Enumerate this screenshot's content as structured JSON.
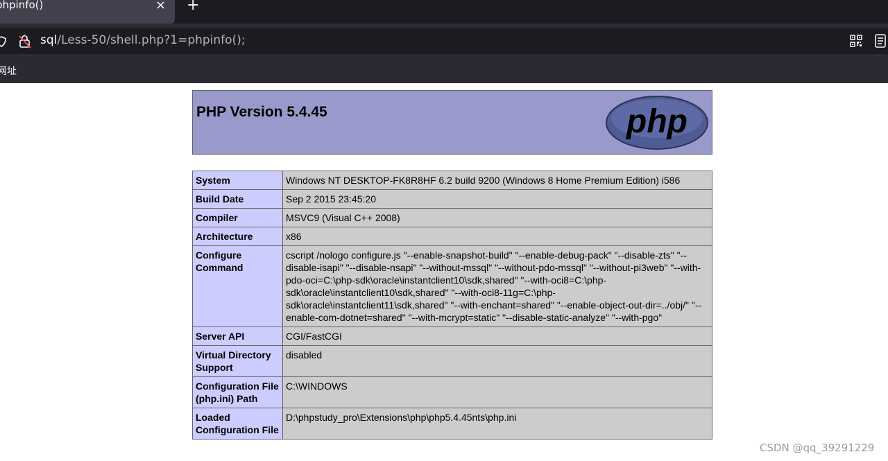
{
  "browser": {
    "tab_title": "phpinfo()",
    "tab_close": "×",
    "new_tab": "+",
    "url_host": "sql",
    "url_path": "/Less-50/shell.php?1=phpinfo();",
    "bookmark_label": "网址",
    "icons": [
      "shield-icon",
      "lock-icon",
      "qr-code-icon",
      "reader-view-icon",
      "close-icon",
      "plus-icon"
    ]
  },
  "page": {
    "heading": "PHP Version 5.4.45",
    "logo_text": "php",
    "rows": [
      {
        "key": "System",
        "value": "Windows NT DESKTOP-FK8R8HF 6.2 build 9200 (Windows 8 Home Premium Edition) i586"
      },
      {
        "key": "Build Date",
        "value": "Sep 2 2015 23:45:20"
      },
      {
        "key": "Compiler",
        "value": "MSVC9 (Visual C++ 2008)"
      },
      {
        "key": "Architecture",
        "value": "x86"
      },
      {
        "key": "Configure Command",
        "value": "cscript /nologo configure.js \"--enable-snapshot-build\" \"--enable-debug-pack\" \"--disable-zts\" \"--disable-isapi\" \"--disable-nsapi\" \"--without-mssql\" \"--without-pdo-mssql\" \"--without-pi3web\" \"--with-pdo-oci=C:\\php-sdk\\oracle\\instantclient10\\sdk,shared\" \"--with-oci8=C:\\php-sdk\\oracle\\instantclient10\\sdk,shared\" \"--with-oci8-11g=C:\\php-sdk\\oracle\\instantclient11\\sdk,shared\" \"--with-enchant=shared\" \"--enable-object-out-dir=../obj/\" \"--enable-com-dotnet=shared\" \"--with-mcrypt=static\" \"--disable-static-analyze\" \"--with-pgo\""
      },
      {
        "key": "Server API",
        "value": "CGI/FastCGI"
      },
      {
        "key": "Virtual Directory Support",
        "value": "disabled"
      },
      {
        "key": "Configuration File (php.ini) Path",
        "value": "C:\\WINDOWS"
      },
      {
        "key": "Loaded Configuration File",
        "value": "D:\\phpstudy_pro\\Extensions\\php\\php5.4.45nts\\php.ini"
      }
    ]
  },
  "watermark": "CSDN @qq_39291229",
  "colors": {
    "header_bg": "#9999cc",
    "key_bg": "#ccccff",
    "value_bg": "#cccccc",
    "chrome_dark": "#1c1b22",
    "chrome": "#2b2a33"
  }
}
